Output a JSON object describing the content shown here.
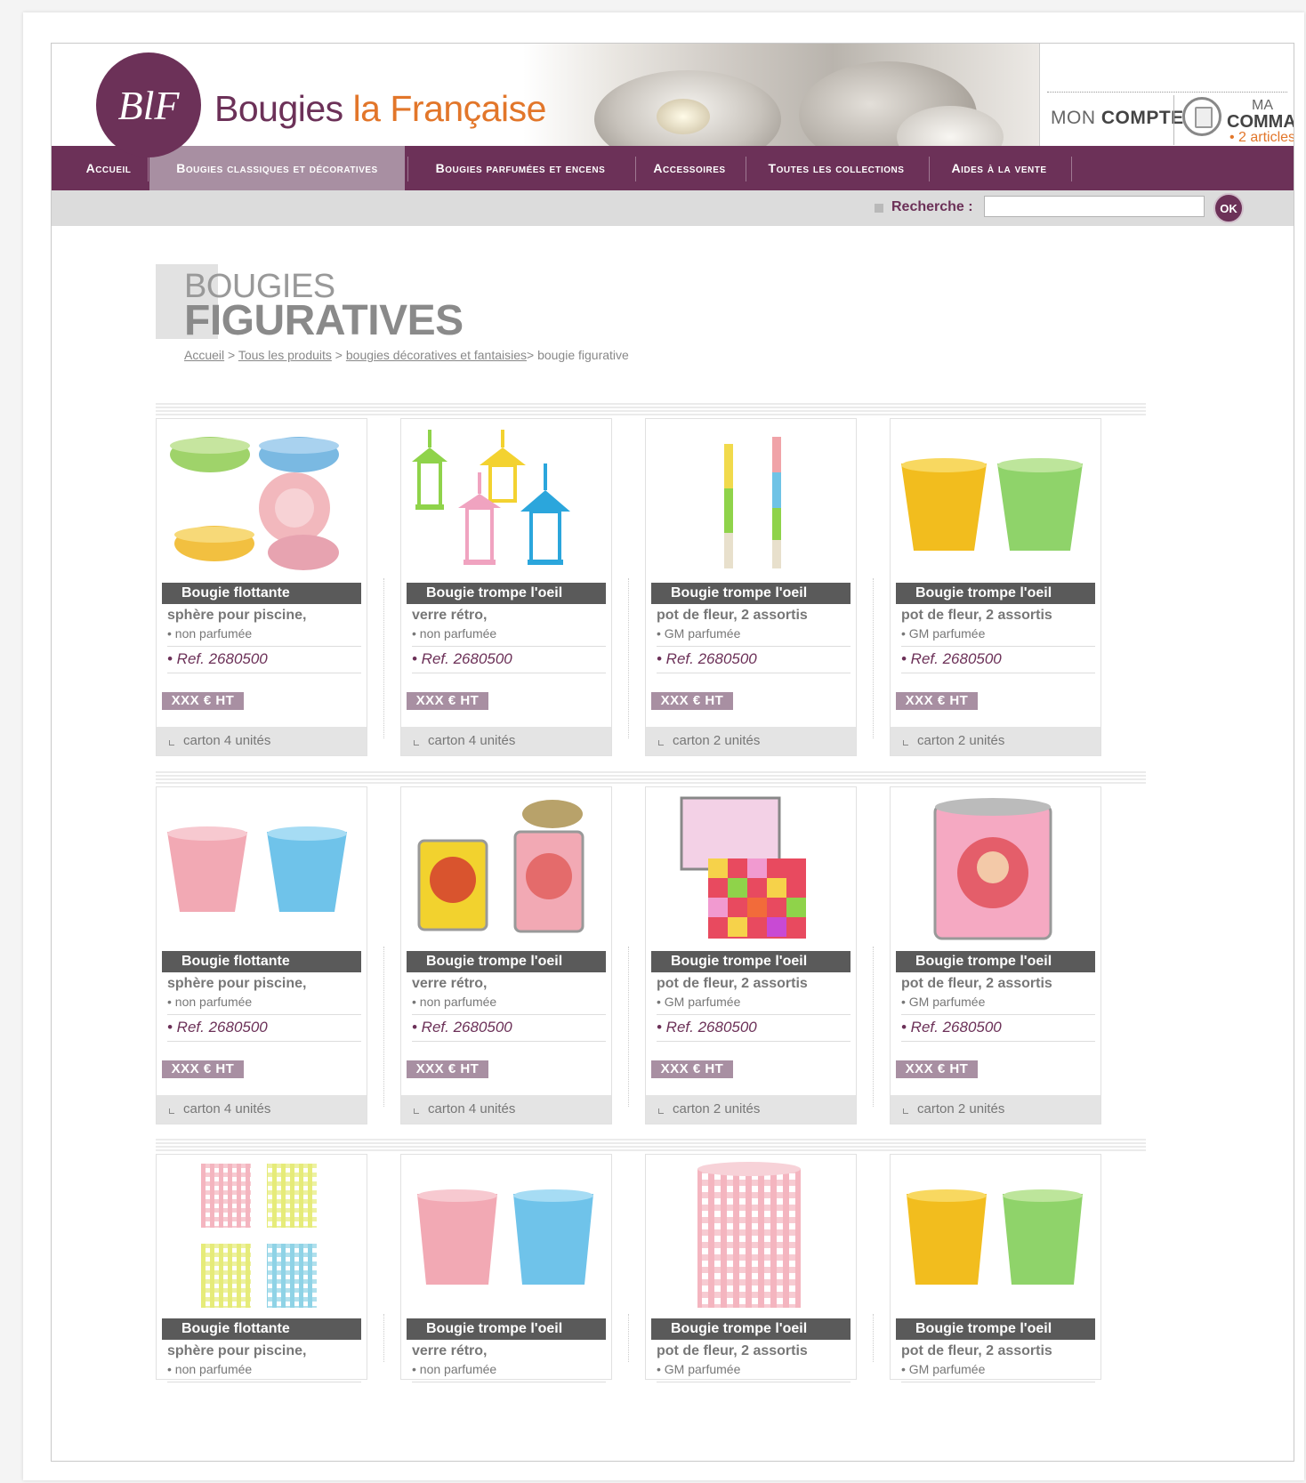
{
  "brand": {
    "logo_text": "BlF",
    "name_part1": "Bougies",
    "name_part2": "la Française",
    "color_primary": "#6c3158",
    "color_accent": "#e2762a"
  },
  "account": {
    "mon": "MON",
    "compte": "COMPTE",
    "ma": "MA",
    "commande": "COMMANDE",
    "count": "• 2 articles"
  },
  "nav": [
    {
      "label": "Accueil"
    },
    {
      "label": "Bougies classiques et décoratives"
    },
    {
      "label": "Bougies parfumées et encens"
    },
    {
      "label": "Accessoires"
    },
    {
      "label": "Toutes les collections"
    },
    {
      "label": "Aides à la vente"
    }
  ],
  "search": {
    "label": "Recherche :",
    "value": "",
    "button": "OK"
  },
  "page": {
    "title_line1": "BOUGIES",
    "title_line2": "FIGURATIVES"
  },
  "breadcrumb": {
    "home": "Accueil",
    "sep1": " > ",
    "all": "Tous les produits",
    "sep2": " > ",
    "cat": "bougies décoratives et fantaisies",
    "current": "> bougie figurative"
  },
  "products": [
    {
      "title": "Bougie flottante",
      "desc": "sphère pour piscine,",
      "sub": "• non parfumée",
      "ref": "• Ref. 2680500",
      "price": "XXX € HT",
      "carton": "carton 4 unités",
      "image": "floating-bowls"
    },
    {
      "title": "Bougie trompe l'oeil",
      "desc": "verre rétro,",
      "sub": "• non parfumée",
      "ref": "• Ref. 2680500",
      "price": "XXX € HT",
      "carton": "carton 4 unités",
      "image": "lanterns"
    },
    {
      "title": "Bougie trompe l'oeil",
      "desc": "pot de fleur, 2 assortis",
      "sub": "• GM parfumée",
      "ref": "• Ref. 2680500",
      "price": "XXX € HT",
      "carton": "carton 2 unités",
      "image": "tapers"
    },
    {
      "title": "Bougie trompe l'oeil",
      "desc": "pot de fleur, 2 assortis",
      "sub": "• GM parfumée",
      "ref": "• Ref. 2680500",
      "price": "XXX € HT",
      "carton": "carton 2 unités",
      "image": "flower-pots-yellow-green"
    },
    {
      "title": "Bougie flottante",
      "desc": "sphère pour piscine,",
      "sub": "• non parfumée",
      "ref": "• Ref. 2680500",
      "price": "XXX € HT",
      "carton": "carton 4 unités",
      "image": "flower-pots-pink-blue"
    },
    {
      "title": "Bougie trompe l'oeil",
      "desc": "verre rétro,",
      "sub": "• non parfumée",
      "ref": "• Ref. 2680500",
      "price": "XXX € HT",
      "carton": "carton 4 unités",
      "image": "tin-cans"
    },
    {
      "title": "Bougie trompe l'oeil",
      "desc": "pot de fleur, 2 assortis",
      "sub": "• GM parfumée",
      "ref": "• Ref. 2680500",
      "price": "XXX € HT",
      "carton": "carton 2 unités",
      "image": "checkered-box"
    },
    {
      "title": "Bougie trompe l'oeil",
      "desc": "pot de fleur, 2 assortis",
      "sub": "• GM parfumée",
      "ref": "• Ref. 2680500",
      "price": "XXX € HT",
      "carton": "carton 2 unités",
      "image": "pinup-tin"
    },
    {
      "title": "Bougie flottante",
      "desc": "sphère pour piscine,",
      "sub": "• non parfumée",
      "ref": "",
      "price": "",
      "carton": "",
      "image": "gingham-glasses"
    },
    {
      "title": "Bougie trompe l'oeil",
      "desc": "verre rétro,",
      "sub": "• non parfumée",
      "ref": "",
      "price": "",
      "carton": "",
      "image": "cups-pink-blue"
    },
    {
      "title": "Bougie trompe l'oeil",
      "desc": "pot de fleur, 2 assortis",
      "sub": "• GM parfumée",
      "ref": "",
      "price": "",
      "carton": "",
      "image": "gingham-tall"
    },
    {
      "title": "Bougie trompe l'oeil",
      "desc": "pot de fleur, 2 assortis",
      "sub": "• GM parfumée",
      "ref": "",
      "price": "",
      "carton": "",
      "image": "cups-yellow-green"
    }
  ]
}
